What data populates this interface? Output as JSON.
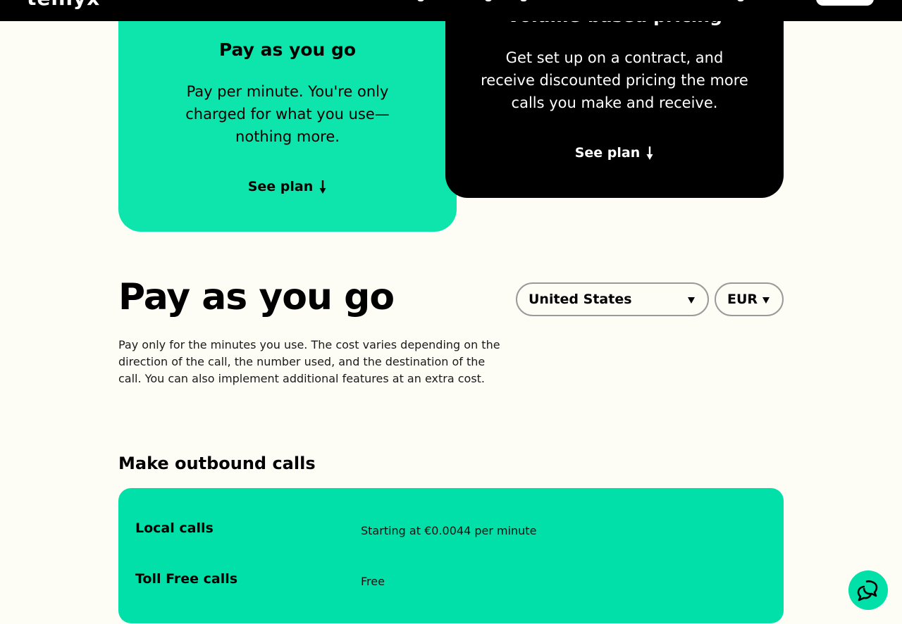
{
  "header": {
    "logo_text": "telnyx"
  },
  "plans": {
    "payg": {
      "title": "Pay as you go",
      "description": "Pay per minute. You're only charged for what you use—nothing more.",
      "cta": "See plan"
    },
    "volume": {
      "title": "Volume-based pricing",
      "description": "Get set up on a contract, and receive discounted pricing the more calls you make and receive.",
      "cta": "See plan"
    }
  },
  "section": {
    "title": "Pay as you go",
    "description": "Pay only for the minutes you use. The cost varies depending on the direction of the call, the number used, and the destination of the call. You can also implement additional features at an extra cost."
  },
  "filters": {
    "country": "United States",
    "currency": "EUR"
  },
  "outbound": {
    "title": "Make outbound calls",
    "rows": [
      {
        "name": "Local calls",
        "value": "Starting at €0.0044 per minute"
      },
      {
        "name": "Toll Free calls",
        "value": "Free"
      }
    ]
  },
  "colors": {
    "accent": "#00e0a8",
    "background": "#fefdf5",
    "dark": "#000000"
  },
  "icons": {
    "arrow": "arrow-down-icon",
    "caret": "chevron-down-icon",
    "chat": "chat-bubbles-icon"
  }
}
